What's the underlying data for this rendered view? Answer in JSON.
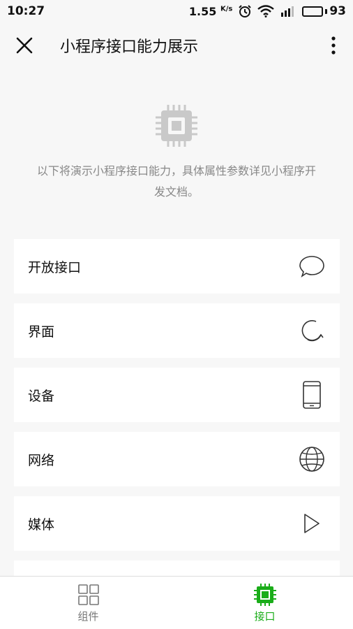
{
  "status_bar": {
    "time": "10:27",
    "speed": "1.55",
    "speed_unit": "K/s",
    "battery": "93"
  },
  "nav": {
    "title": "小程序接口能力展示"
  },
  "hero": {
    "description": "以下将演示小程序接口能力，具体属性参数详见小程序开发文档。"
  },
  "list": {
    "items": [
      {
        "label": "开放接口",
        "icon": "chat-bubble-icon"
      },
      {
        "label": "界面",
        "icon": "refresh-icon"
      },
      {
        "label": "设备",
        "icon": "phone-icon"
      },
      {
        "label": "网络",
        "icon": "globe-icon"
      },
      {
        "label": "媒体",
        "icon": "play-icon"
      }
    ]
  },
  "tab_bar": {
    "tabs": [
      {
        "label": "组件",
        "icon": "grid-icon",
        "active": false
      },
      {
        "label": "接口",
        "icon": "chip-icon",
        "active": true
      }
    ]
  },
  "colors": {
    "accent": "#1aad19",
    "background": "#f7f7f7",
    "secondary_text": "#888888"
  }
}
